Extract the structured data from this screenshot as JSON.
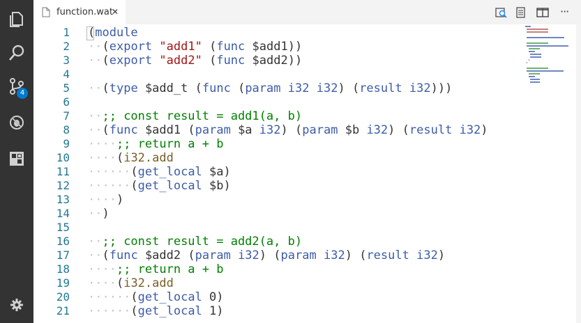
{
  "activity_bar": {
    "icons": [
      "files-icon",
      "search-icon",
      "source-control-icon",
      "debug-icon",
      "extensions-icon",
      "settings-gear-icon"
    ],
    "source_control_badge": "4"
  },
  "tab": {
    "title": "function.wat",
    "close": "✕"
  },
  "editor_actions": [
    "open-changes-icon",
    "open-preview-icon",
    "split-editor-icon",
    "more-actions-icon"
  ],
  "more_label": "···",
  "line_numbers": [
    "1",
    "2",
    "3",
    "4",
    "5",
    "6",
    "7",
    "8",
    "9",
    "10",
    "11",
    "12",
    "13",
    "14",
    "15",
    "16",
    "17",
    "18",
    "19",
    "20",
    "21"
  ],
  "code_lines": [
    "(module",
    "  (export \"add1\" (func $add1))",
    "  (export \"add2\" (func $add2))",
    "",
    "  (type $add_t (func (param i32 i32) (result i32)))",
    "",
    "  ;; const result = add1(a, b)",
    "  (func $add1 (param $a i32) (param $b i32) (result i32)",
    "    ;; return a + b",
    "    (i32.add",
    "      (get_local $a)",
    "      (get_local $b)",
    "    )",
    "  )",
    "",
    "  ;; const result = add2(a, b)",
    "  (func $add2 (param i32) (param i32) (result i32)",
    "    ;; return a + b",
    "    (i32.add",
    "      (get_local 0)",
    "      (get_local 1)"
  ],
  "colors": {
    "activity_bg": "#333333",
    "badge": "#007acc",
    "line_number": "#237893",
    "keyword": "#3c5ca8",
    "string": "#a31515",
    "comment": "#008000"
  }
}
